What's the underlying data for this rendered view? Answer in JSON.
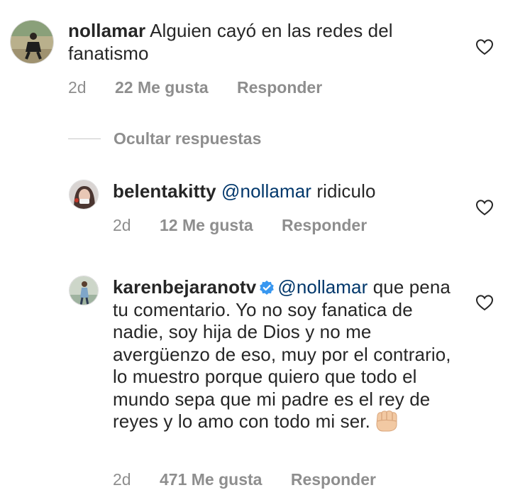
{
  "comments": [
    {
      "username": "nollamar",
      "text": "Alguien cayó en las redes del fanatismo",
      "age": "2d",
      "likes": "22 Me gusta",
      "reply": "Responder"
    }
  ],
  "replies_toggle": "Ocultar respuestas",
  "replies": [
    {
      "username": "belentakitty",
      "mention": "@nollamar",
      "text": "ridiculo",
      "age": "2d",
      "likes": "12 Me gusta",
      "reply": "Responder"
    },
    {
      "username": "karenbejaranotv",
      "verified": true,
      "mention": "@nollamar",
      "text": "que pena tu comentario. Yo no soy fanatica de nadie, soy hija de Dios y no me avergüenzo de eso, muy por el contrario, lo muestro porque quiero que todo el mundo sepa que mi padre es el rey de reyes y lo amo con todo mi ser.",
      "emoji": "fist-icon",
      "age": "2d",
      "likes": "471 Me gusta",
      "reply": "Responder"
    }
  ],
  "colors": {
    "text": "#262626",
    "meta": "#8e8e8e",
    "mention": "#00376b",
    "verified": "#3897f0"
  }
}
